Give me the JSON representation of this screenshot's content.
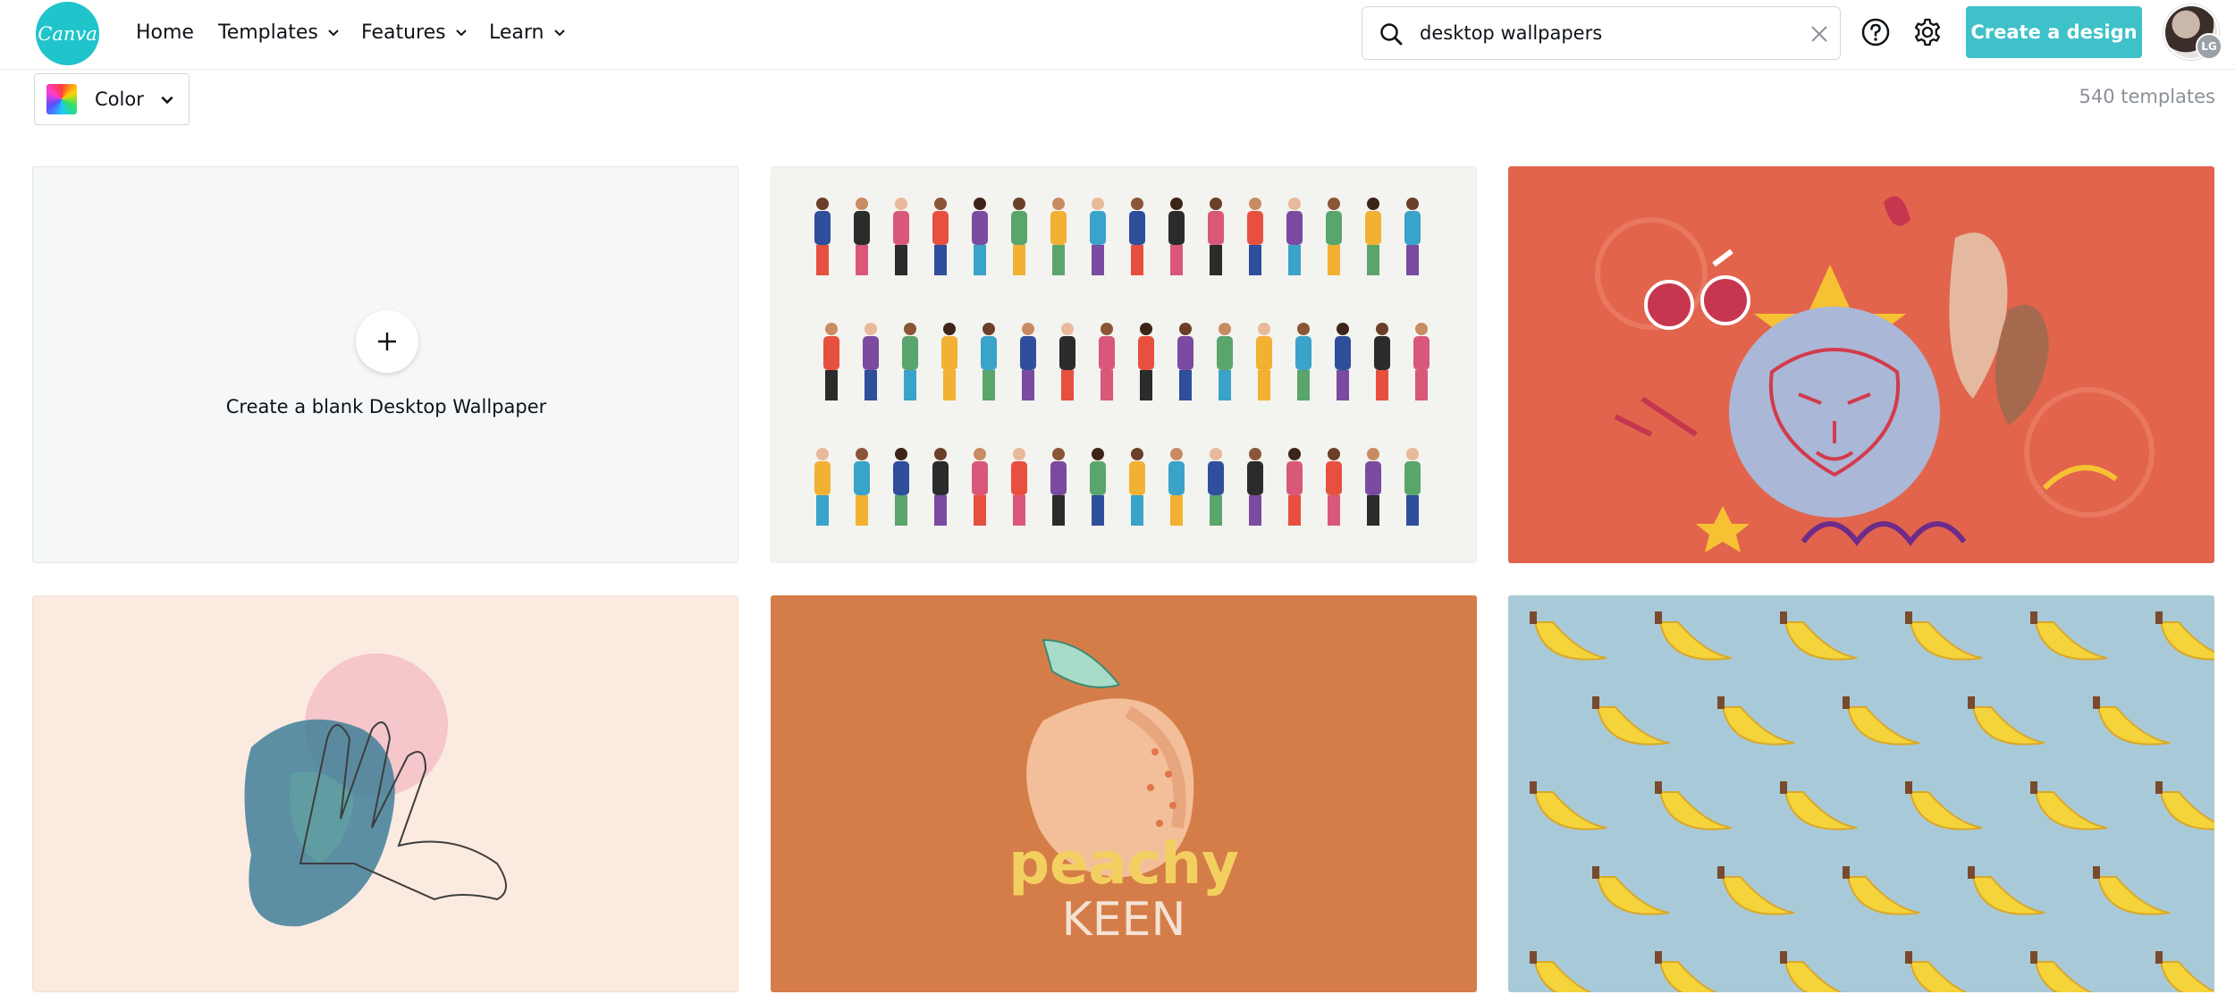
{
  "logo_text": "Canva",
  "nav": {
    "items": [
      {
        "label": "Home",
        "has_dropdown": false
      },
      {
        "label": "Templates",
        "has_dropdown": true
      },
      {
        "label": "Features",
        "has_dropdown": true
      },
      {
        "label": "Learn",
        "has_dropdown": true
      }
    ]
  },
  "search": {
    "value": "desktop wallpapers"
  },
  "header": {
    "create_label": "Create a design",
    "avatar_initials": "LG"
  },
  "toolbar": {
    "color_label": "Color",
    "count": "540 templates"
  },
  "blank_card": {
    "label": "Create a blank Desktop Wallpaper"
  },
  "templates": [
    {
      "name": "people-illustration",
      "background": "#f3f3ef"
    },
    {
      "name": "tiger-collage",
      "background": "#e2644c"
    },
    {
      "name": "watercolor-hands",
      "background": "#fbeae0"
    },
    {
      "name": "peachy-keen",
      "background": "#d57d48",
      "text_line1": "peachy",
      "text_line2": "KEEN"
    },
    {
      "name": "banana-pattern",
      "background": "#a8cad8"
    }
  ],
  "colors": {
    "accent": "#3ec1c9",
    "logo": "#20c4cb"
  }
}
